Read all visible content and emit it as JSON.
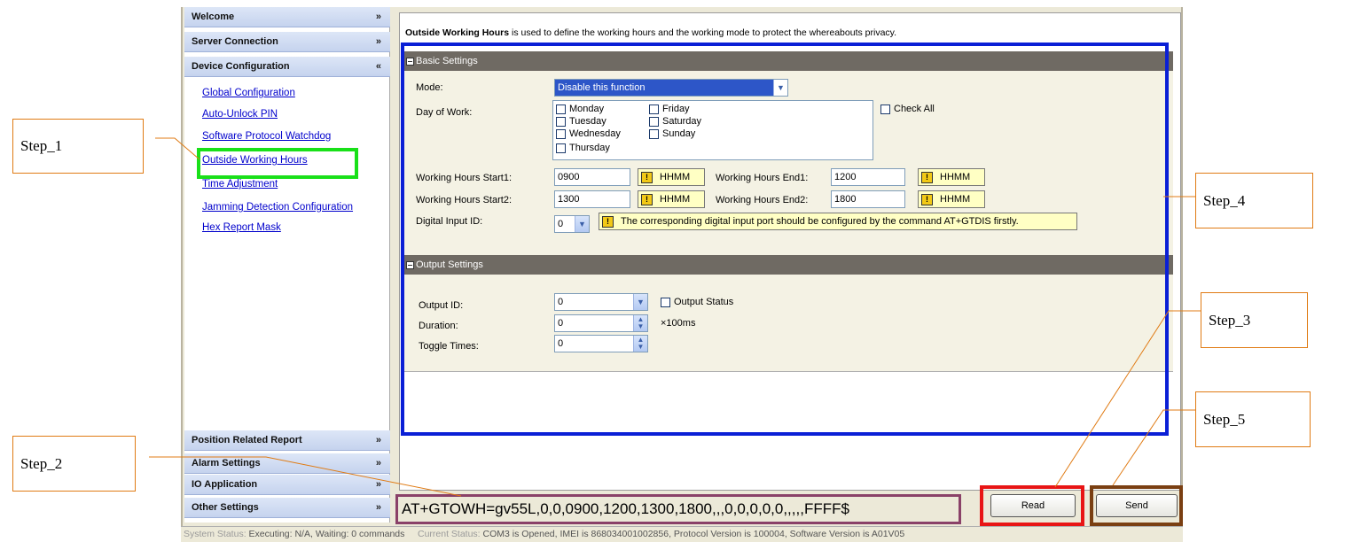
{
  "sidebar": {
    "headers_top": [
      {
        "label": "Welcome",
        "chevron": "double-down"
      },
      {
        "label": "Server Connection",
        "chevron": "double-down"
      },
      {
        "label": "Device Configuration",
        "chevron": "double-up"
      }
    ],
    "links": [
      "Global Configuration",
      "Auto-Unlock PIN",
      "Software Protocol Watchdog",
      "Outside Working Hours",
      "Time Adjustment",
      "Jamming Detection Configuration",
      "Hex Report Mask"
    ],
    "headers_bottom": [
      {
        "label": "Position Related Report"
      },
      {
        "label": "Alarm Settings"
      },
      {
        "label": "IO Application"
      },
      {
        "label": "Other Settings"
      }
    ],
    "chevron_down": "»",
    "chevron_up": "«"
  },
  "main": {
    "intro_bold": "Outside Working Hours",
    "intro_rest": " is used to define the working hours and the working mode to protect the whereabouts privacy.",
    "basic": {
      "title": "Basic Settings",
      "mode_label": "Mode:",
      "mode_value": "Disable this function",
      "day_label": "Day of Work:",
      "days_col1": [
        "Monday",
        "Tuesday",
        "Wednesday",
        "Thursday"
      ],
      "days_col2": [
        "Friday",
        "Saturday",
        "Sunday"
      ],
      "check_all": "Check All",
      "start1_label": "Working Hours Start1:",
      "start1_value": "0900",
      "end1_label": "Working Hours End1:",
      "end1_value": "1200",
      "start2_label": "Working Hours Start2:",
      "start2_value": "1300",
      "end2_label": "Working Hours End2:",
      "end2_value": "1800",
      "hhmm": "HHMM",
      "din_label": "Digital Input ID:",
      "din_value": "0",
      "din_hint": "The corresponding digital input port should be configured by the command AT+GTDIS firstly."
    },
    "output": {
      "title": "Output Settings",
      "output_id_label": "Output ID:",
      "output_id_value": "0",
      "output_status": "Output Status",
      "duration_label": "Duration:",
      "duration_value": "0",
      "duration_unit": "×100ms",
      "toggle_label": "Toggle Times:",
      "toggle_value": "0"
    }
  },
  "command": "AT+GTOWH=gv55L,0,0,0900,1200,1300,1800,,,0,0,0,0,0,,,,,FFFF$",
  "buttons": {
    "read": "Read",
    "send": "Send"
  },
  "status": {
    "system_label": "System Status:",
    "system_value": "Executing: N/A, Waiting: 0 commands",
    "current_label": "Current Status:",
    "current_value": "COM3 is Opened, IMEI is 868034001002856, Protocol Version is 100004, Software Version is A01V05"
  },
  "steps": [
    "Step_1",
    "Step_2",
    "Step_3",
    "Step_4",
    "Step_5"
  ],
  "colors": {
    "step1_frame": "#19e019",
    "step3_frame": "#e81515",
    "step4_frame": "#0a1fd6",
    "step5_frame": "#7a3f12",
    "step2_frame": "#8a4168",
    "leader": "#e07b14"
  }
}
